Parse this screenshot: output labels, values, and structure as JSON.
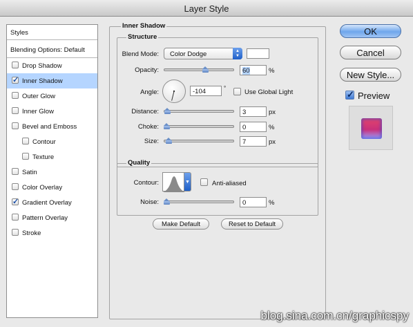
{
  "window": {
    "title": "Layer Style"
  },
  "styles_list": {
    "header": "Styles",
    "blending": "Blending Options: Default",
    "items": [
      {
        "label": "Drop Shadow",
        "checked": false,
        "selected": false,
        "indent": false
      },
      {
        "label": "Inner Shadow",
        "checked": true,
        "selected": true,
        "indent": false
      },
      {
        "label": "Outer Glow",
        "checked": false,
        "selected": false,
        "indent": false
      },
      {
        "label": "Inner Glow",
        "checked": false,
        "selected": false,
        "indent": false
      },
      {
        "label": "Bevel and Emboss",
        "checked": false,
        "selected": false,
        "indent": false
      },
      {
        "label": "Contour",
        "checked": false,
        "selected": false,
        "indent": true
      },
      {
        "label": "Texture",
        "checked": false,
        "selected": false,
        "indent": true
      },
      {
        "label": "Satin",
        "checked": false,
        "selected": false,
        "indent": false
      },
      {
        "label": "Color Overlay",
        "checked": false,
        "selected": false,
        "indent": false
      },
      {
        "label": "Gradient Overlay",
        "checked": true,
        "selected": false,
        "indent": false
      },
      {
        "label": "Pattern Overlay",
        "checked": false,
        "selected": false,
        "indent": false
      },
      {
        "label": "Stroke",
        "checked": false,
        "selected": false,
        "indent": false
      }
    ]
  },
  "inner_shadow": {
    "title": "Inner Shadow",
    "structure": {
      "title": "Structure",
      "blend_mode_label": "Blend Mode:",
      "blend_mode_value": "Color Dodge",
      "blend_color": "#ffffff",
      "opacity_label": "Opacity:",
      "opacity_value": "60",
      "opacity_unit": "%",
      "opacity_fraction": 0.6,
      "angle_label": "Angle:",
      "angle_value": "-104",
      "angle_unit": "°",
      "use_global_light_label": "Use Global Light",
      "use_global_light": false,
      "distance_label": "Distance:",
      "distance_value": "3",
      "distance_unit": "px",
      "distance_fraction": 0.01,
      "choke_label": "Choke:",
      "choke_value": "0",
      "choke_unit": "%",
      "choke_fraction": 0,
      "size_label": "Size:",
      "size_value": "7",
      "size_unit": "px",
      "size_fraction": 0.03
    },
    "quality": {
      "title": "Quality",
      "contour_label": "Contour:",
      "anti_aliased_label": "Anti-aliased",
      "anti_aliased": false,
      "noise_label": "Noise:",
      "noise_value": "0",
      "noise_unit": "%",
      "noise_fraction": 0
    },
    "make_default": "Make Default",
    "reset_default": "Reset to Default"
  },
  "buttons": {
    "ok": "OK",
    "cancel": "Cancel",
    "new_style": "New Style...",
    "preview_label": "Preview",
    "preview_checked": true
  },
  "colors": {
    "accent": "#6ea6ec",
    "selection": "#b5d5ff"
  },
  "watermark": "blog.sina.com.cn/graphicspy"
}
